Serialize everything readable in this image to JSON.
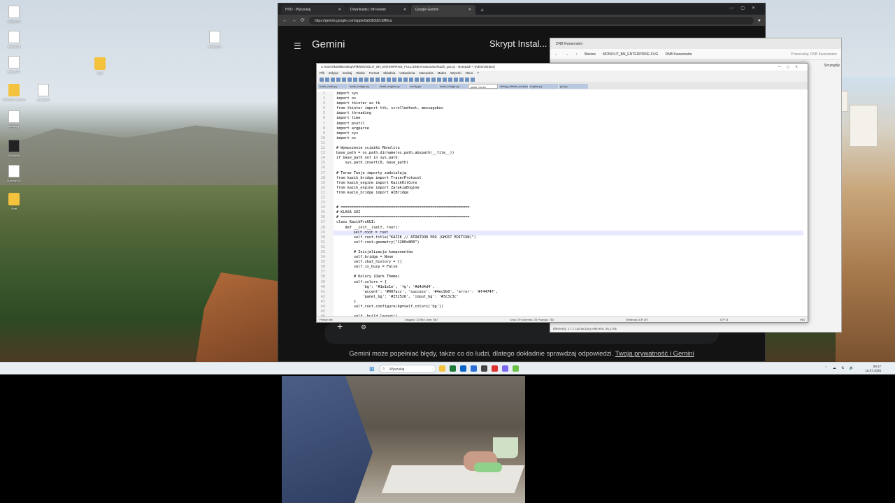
{
  "desktop": {
    "icons": [
      {
        "label": "essay 034",
        "kind": "file"
      },
      {
        "label": "essay 035",
        "kind": "file"
      },
      {
        "label": "essay 037",
        "kind": "file"
      },
      {
        "label": "MONOLIT_BUILD",
        "kind": "folder"
      },
      {
        "label": "essay.py",
        "kind": "file"
      },
      {
        "label": "TERMINAL",
        "kind": "exe"
      },
      {
        "label": "HARNESS",
        "kind": "file"
      },
      {
        "label": "Stuff",
        "kind": "folder"
      },
      {
        "label": "Stuff",
        "kind": "folder"
      },
      {
        "label": "essay 038",
        "kind": "file"
      },
      {
        "label": "prompt.txt",
        "kind": "file"
      }
    ]
  },
  "chrome": {
    "tabs": [
      {
        "label": "HVD - Wyszukaj"
      },
      {
        "label": "Downloads | mh-owner"
      },
      {
        "label": "Google Gemini"
      }
    ],
    "url": "https://gemini.google.com/app/e0a5383d2cfdff6ca",
    "gemini": {
      "brand": "Gemini",
      "chat_title": "Skrypt Instal...",
      "disclaimer": "Gemini może popełniać błędy, także co do ludzi, dlatego dokładnie sprawdzaj odpowiedzi.",
      "privacy_link": "Twoja prywatność i Gemini"
    }
  },
  "explorer": {
    "tab": "DNB Kwasonator",
    "path": [
      "Wariwe",
      "MONOLIT_BN_ENTERPRISE-FUG",
      "DNB Kwasonator"
    ],
    "search_placeholder": "Przeszukaj: DNB Kwasonator",
    "side_button": "Szczegóły",
    "status": "Elementy: 17   1 zaznaczony element: 25,1 KB"
  },
  "notepad": {
    "title": "C:\\Users\\kaitil\\Desktop\\Pliki\\MONOLIT_BN_ENTERPRISE_FULL\\DNB Kwasonator\\kazik_gui.py - Notepad++ [Administrator]",
    "menu": [
      "Plik",
      "Edycja",
      "Szukaj",
      "Widok",
      "Format",
      "Składnia",
      "Ustawienia",
      "Narzędzia",
      "Makra",
      "Wtyczki",
      "Okno",
      "?"
    ],
    "file_tabs": [
      "kazik_main.py",
      "kazik_bridge.py",
      "kazik_engine.py",
      "config.py",
      "kazik_bridge.py",
      "kazik_gui.py",
      "debug_offsets_script.py",
      "engine.py",
      "gui.py"
    ],
    "status_left": "Python file",
    "status_length": "Długość: 23 984   Linie: 567",
    "status_pos": "Linia: 29   Kolumna: 25   Pozycja: 782",
    "status_eol": "Windows (CR LF)",
    "status_enc": "UTF-8",
    "status_mode": "INS",
    "lines": [
      {
        "n": "1",
        "code": "import sys"
      },
      {
        "n": "2",
        "code": "import os"
      },
      {
        "n": "3",
        "code": "import tkinter as tk"
      },
      {
        "n": "4",
        "code": "from tkinter import ttk, scrolledtext, messagebox"
      },
      {
        "n": "5",
        "code": "import threading"
      },
      {
        "n": "6",
        "code": "import time"
      },
      {
        "n": "7",
        "code": "import psutil"
      },
      {
        "n": "8",
        "code": "import argparse"
      },
      {
        "n": "9",
        "code": "import sys"
      },
      {
        "n": "10",
        "code": "import os"
      },
      {
        "n": "11",
        "code": ""
      },
      {
        "n": "12",
        "code": "# Wymuszenie scieżki Monolitu"
      },
      {
        "n": "13",
        "code": "base_path = os.path.dirname(os.path.abspath(__file__))"
      },
      {
        "n": "14",
        "code": "if base_path not in sys.path:"
      },
      {
        "n": "15",
        "code": "    sys.path.insert(0, base_path)"
      },
      {
        "n": "16",
        "code": ""
      },
      {
        "n": "17",
        "code": "# Teraz Twoje importy zadziałają"
      },
      {
        "n": "18",
        "code": "from kazik_bridge import TracerProtocol"
      },
      {
        "n": "19",
        "code": "from kazik_engine import KazikHitCore"
      },
      {
        "n": "20",
        "code": "from kazik_engine import ZarakiaEngine"
      },
      {
        "n": "21",
        "code": "from kazik_bridge import AIBridge"
      },
      {
        "n": "22",
        "code": ""
      },
      {
        "n": "23",
        "code": ""
      },
      {
        "n": "24",
        "code": "# ==========================================================="
      },
      {
        "n": "25",
        "code": "# KLASA GUI"
      },
      {
        "n": "26",
        "code": "# ==========================================================="
      },
      {
        "n": "27",
        "code": "class KazikProGUI:"
      },
      {
        "n": "28",
        "code": "    def __init__(self, root):"
      },
      {
        "n": "29",
        "code": "        self.root = root"
      },
      {
        "n": "30",
        "code": "        self.root.title(\"KAZIK // ATRATOOR PRO (GHOST EDITION)\")"
      },
      {
        "n": "31",
        "code": "        self.root.geometry(\"1280x800\")"
      },
      {
        "n": "32",
        "code": ""
      },
      {
        "n": "33",
        "code": "        # Inicjalizacja komponentów"
      },
      {
        "n": "34",
        "code": "        self.bridge = None"
      },
      {
        "n": "35",
        "code": "        self.chat_history = []"
      },
      {
        "n": "36",
        "code": "        self.is_busy = False"
      },
      {
        "n": "37",
        "code": ""
      },
      {
        "n": "38",
        "code": "        # Kolory (Dark Theme)"
      },
      {
        "n": "39",
        "code": "        self.colors = {"
      },
      {
        "n": "40",
        "code": "            'bg': '#1e1e1e', 'fg': '#d4d4d4',"
      },
      {
        "n": "41",
        "code": "            'accent': '#007acc', 'success': '#4ec9b0', 'error': '#f44747',"
      },
      {
        "n": "42",
        "code": "            'panel_bg': '#252526', 'input_bg': '#3c3c3c'"
      },
      {
        "n": "43",
        "code": "        }"
      },
      {
        "n": "44",
        "code": "        self.root.configure(bg=self.colors['bg'])"
      },
      {
        "n": "45",
        "code": ""
      },
      {
        "n": "46",
        "code": "        self._build_layout()"
      }
    ]
  },
  "taskbar": {
    "search_placeholder": "Wyszukaj",
    "time": "09:17",
    "date": "18.07.2025"
  }
}
